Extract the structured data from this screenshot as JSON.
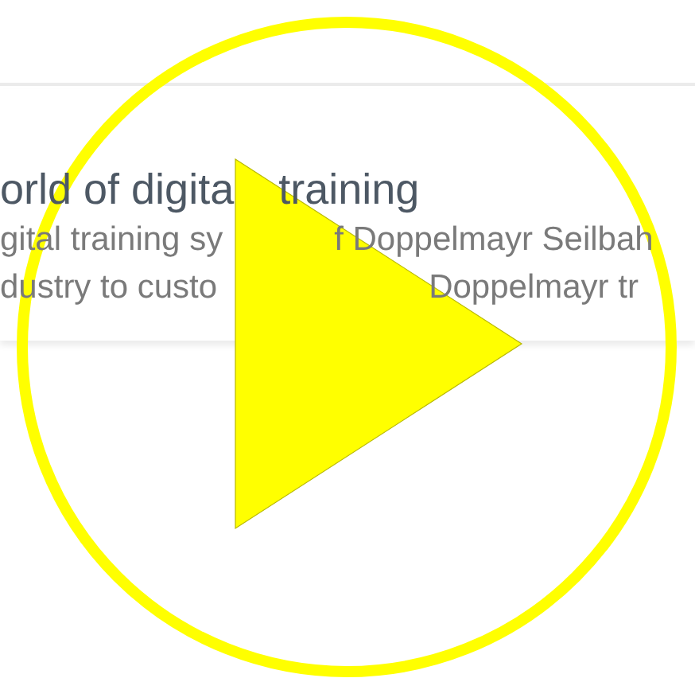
{
  "card": {
    "title": [
      "orld of digita",
      "training"
    ],
    "lines": [
      [
        "gital training sy",
        "f Doppelmayr Seilbah"
      ],
      [
        "dustry to custo",
        "Doppelmayr tr"
      ]
    ]
  },
  "play_button": {
    "shown": true
  }
}
